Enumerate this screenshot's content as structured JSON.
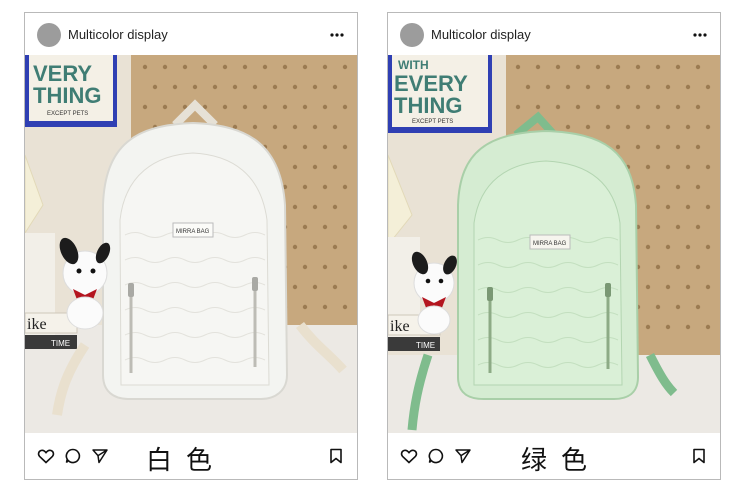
{
  "posts": [
    {
      "header_title": "Multicolor display",
      "caption": "白色",
      "icons": [
        "heart-icon",
        "comment-icon",
        "send-icon",
        "bookmark-icon",
        "more-icon"
      ],
      "bag_color": "#f3f4f1",
      "poster_text": "EVERY THING",
      "poster_subtext": "EXCEPT PETS",
      "bag_label": "MIRRA BAG"
    },
    {
      "header_title": "Multicolor display",
      "caption": "绿色",
      "icons": [
        "heart-icon",
        "comment-icon",
        "send-icon",
        "bookmark-icon",
        "more-icon"
      ],
      "bag_color": "#d5ecd2",
      "poster_text": "WITH EVERY THING",
      "poster_subtext": "EXCEPT PETS",
      "bag_label": "MIRRA BAG"
    }
  ]
}
